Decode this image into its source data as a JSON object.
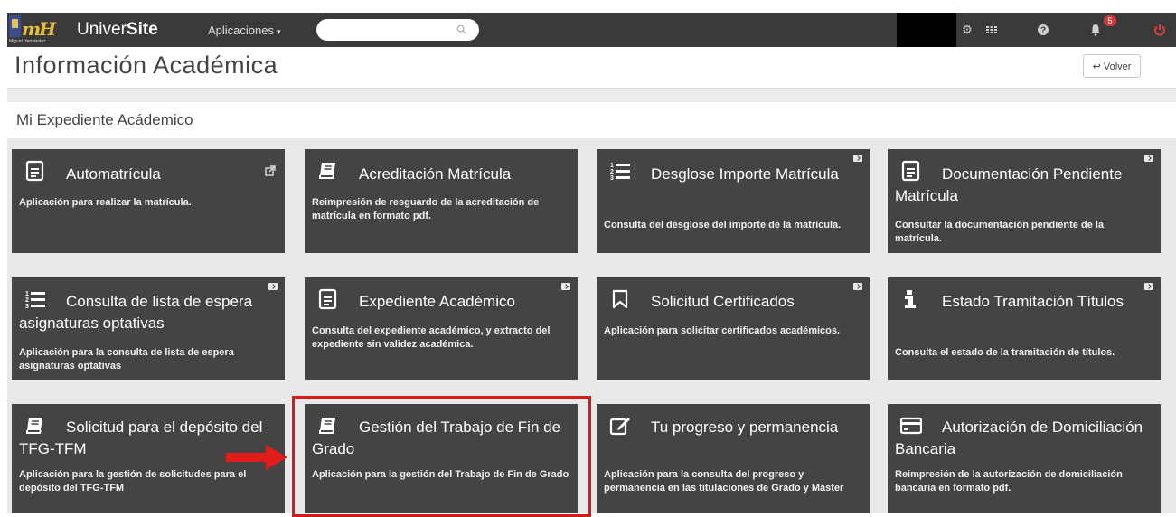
{
  "navbar": {
    "brand_prefix": "Univer",
    "brand_bold": "Site",
    "apps_label": "Aplicaciones",
    "search_placeholder": "",
    "notifications_count": "5",
    "logo_caption": "Miguel Hernández",
    "icons": [
      "gear-icon",
      "grid-icon",
      "help-icon",
      "bell-icon",
      "power-icon"
    ]
  },
  "header": {
    "title": "Información Académica",
    "back_label": "Volver"
  },
  "section": {
    "title": "Mi Expediente Acádemico"
  },
  "tiles": [
    {
      "title": "Automatrícula",
      "desc": "Aplicación para realizar la matrícula.",
      "icon": "document-icon"
    },
    {
      "title": "Acreditación Matrícula",
      "desc": "Reimpresión de resguardo de la acreditación de matrícula en formato pdf.",
      "icon": "book-icon"
    },
    {
      "title": "Desglose Importe Matrícula",
      "desc": "Consulta del desglose del importe de la matrícula.",
      "icon": "ordered-list-icon"
    },
    {
      "title": "Documentación Pendiente Matrícula",
      "desc": "Consultar la documentación pendiente de la matrícula.",
      "icon": "document-icon"
    },
    {
      "title": "Consulta de lista de espera asignaturas optativas",
      "desc": "Aplicación para la consulta de lista de espera asignaturas optativas",
      "icon": "ordered-list-icon"
    },
    {
      "title": "Expediente Académico",
      "desc": "Consulta del expediente académico, y extracto del expediente sin validez académica.",
      "icon": "document-icon"
    },
    {
      "title": "Solicitud Certificados",
      "desc": "Aplicación para solicitar certificados académicos.",
      "icon": "bookmark-icon"
    },
    {
      "title": "Estado Tramitación Títulos",
      "desc": "Consulta el estado de la tramitación de títulos.",
      "icon": "info-icon"
    },
    {
      "title": "Solicitud para el depósito del TFG-TFM",
      "desc": "Aplicación para la gestión de solicitudes para el depósito del TFG-TFM",
      "icon": "book-icon"
    },
    {
      "title": "Gestión del Trabajo de Fin de Grado",
      "desc": "Aplicación para la gestión del Trabajo de Fin de Grado",
      "icon": "book-icon"
    },
    {
      "title": "Tu progreso y permanencia",
      "desc": "Aplicación para la consulta del progreso y permanencia en las titulaciones de Grado y Máster",
      "icon": "edit-icon"
    },
    {
      "title": "Autorización de Domiciliación Bancaria",
      "desc": "Reimpresión de la autorización de domiciliación bancaria en formato pdf.",
      "icon": "credit-card-icon"
    }
  ],
  "colors": {
    "navbar": "#3a3a3a",
    "tile": "#444444",
    "highlight": "#d71a1a",
    "badge": "#d23b3b",
    "logo": "#e6c03a"
  }
}
